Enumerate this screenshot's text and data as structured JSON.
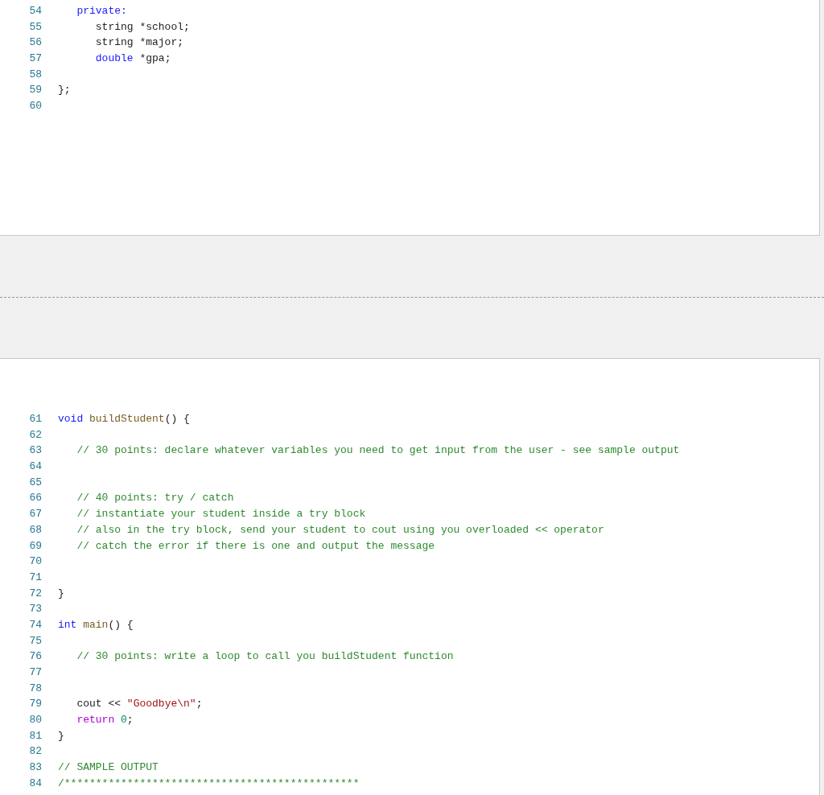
{
  "panels": [
    {
      "lines": [
        {
          "number": "54",
          "tokens": [
            {
              "text": "   private:",
              "kind": "keyword"
            }
          ]
        },
        {
          "number": "55",
          "tokens": [
            {
              "text": "      string *school;",
              "kind": "plain"
            }
          ]
        },
        {
          "number": "56",
          "tokens": [
            {
              "text": "      string *major;",
              "kind": "plain"
            }
          ]
        },
        {
          "number": "57",
          "tokens": [
            {
              "text": "      double",
              "kind": "keyword"
            },
            {
              "text": " *gpa;",
              "kind": "plain"
            }
          ]
        },
        {
          "number": "58"
        },
        {
          "number": "59",
          "tokens": [
            {
              "text": "};",
              "kind": "plain"
            }
          ]
        },
        {
          "number": "60"
        }
      ]
    },
    {
      "lines": [
        {
          "number": "61",
          "tokens": [
            {
              "text": "void",
              "kind": "keyword"
            },
            {
              "text": " buildStudent",
              "kind": "function"
            },
            {
              "text": "() {",
              "kind": "plain"
            }
          ]
        },
        {
          "number": "62"
        },
        {
          "number": "63",
          "tokens": [
            {
              "text": "   // 30 points: declare whatever variables you need to get input from the user - see sample output",
              "kind": "comment"
            }
          ]
        },
        {
          "number": "64"
        },
        {
          "number": "65"
        },
        {
          "number": "66",
          "tokens": [
            {
              "text": "   // 40 points: try / catch",
              "kind": "comment"
            }
          ]
        },
        {
          "number": "67",
          "tokens": [
            {
              "text": "   // instantiate your student inside a try block",
              "kind": "comment"
            }
          ]
        },
        {
          "number": "68",
          "tokens": [
            {
              "text": "   // also in the try block, send your student to cout using you overloaded << operator",
              "kind": "comment"
            }
          ]
        },
        {
          "number": "69",
          "tokens": [
            {
              "text": "   // catch the error if there is one and output the message",
              "kind": "comment"
            }
          ]
        },
        {
          "number": "70"
        },
        {
          "number": "71"
        },
        {
          "number": "72",
          "tokens": [
            {
              "text": "}",
              "kind": "plain"
            }
          ]
        },
        {
          "number": "73"
        },
        {
          "number": "74",
          "tokens": [
            {
              "text": "int",
              "kind": "keyword"
            },
            {
              "text": " main",
              "kind": "function"
            },
            {
              "text": "() {",
              "kind": "plain"
            }
          ]
        },
        {
          "number": "75"
        },
        {
          "number": "76",
          "tokens": [
            {
              "text": "   // 30 points: write a loop to call you buildStudent function",
              "kind": "comment"
            }
          ]
        },
        {
          "number": "77"
        },
        {
          "number": "78"
        },
        {
          "number": "79",
          "tokens": [
            {
              "text": "   cout << ",
              "kind": "plain"
            },
            {
              "text": "\"Goodbye\\n\"",
              "kind": "string"
            },
            {
              "text": ";",
              "kind": "plain"
            }
          ]
        },
        {
          "number": "80",
          "tokens": [
            {
              "text": "   return",
              "kind": "control"
            },
            {
              "text": " 0",
              "kind": "number"
            },
            {
              "text": ";",
              "kind": "plain"
            }
          ]
        },
        {
          "number": "81",
          "tokens": [
            {
              "text": "}",
              "kind": "plain"
            }
          ]
        },
        {
          "number": "82"
        },
        {
          "number": "83",
          "tokens": [
            {
              "text": "// SAMPLE OUTPUT",
              "kind": "comment"
            }
          ]
        },
        {
          "number": "84",
          "tokens": [
            {
              "text": "/***********************************************",
              "kind": "comment"
            }
          ]
        }
      ]
    }
  ]
}
